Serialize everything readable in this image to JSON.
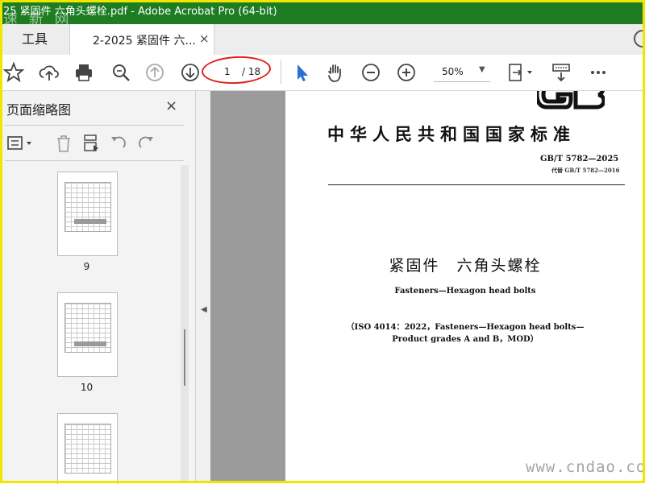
{
  "window": {
    "title": "25 紧固件 六角头螺栓.pdf - Adobe Acrobat Pro (64-bit)",
    "title_bar_color": "#1e7d23",
    "frame_color": "#f2e600",
    "watermark_top": "速 新 网"
  },
  "tabs": {
    "tools": "工具",
    "document": "2-2025 紧固件 六...",
    "close": "×"
  },
  "toolbar": {
    "page_current": "1",
    "page_total": "/ 18",
    "zoom": "50%",
    "highlight_color": "#e0201c",
    "accent": "#2b6fd6"
  },
  "sidebar": {
    "title": "页面缩略图",
    "close": "×",
    "thumbnails": [
      {
        "label": "9"
      },
      {
        "label": "10"
      },
      {
        "label": ""
      }
    ]
  },
  "page": {
    "national_standard": "中华人民共和国国家标准",
    "code": "GB/T 5782—2025",
    "replaces": "代替 GB/T 5782—2016",
    "title_cn": "紧固件　六角头螺栓",
    "title_en": "Fasteners—Hexagon head bolts",
    "iso_line1": "（ISO 4014：2022，Fasteners—Hexagon head bolts—",
    "iso_line2": "Product grades A and B，MOD）"
  },
  "watermark_bottom": "www.cndao.com"
}
